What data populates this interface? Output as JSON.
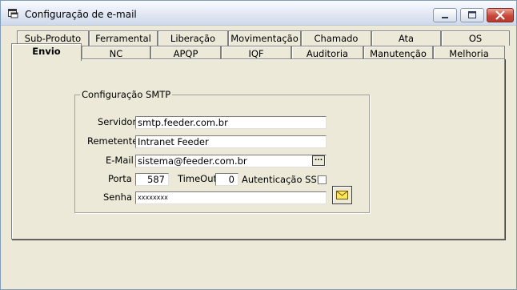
{
  "window": {
    "title": "Configuração de e-mail"
  },
  "tabs_row1": [
    {
      "label": "Sub-Produto"
    },
    {
      "label": "Ferramental"
    },
    {
      "label": "Liberação"
    },
    {
      "label": "Movimentação"
    },
    {
      "label": "Chamado"
    },
    {
      "label": "Ata"
    },
    {
      "label": "OS"
    }
  ],
  "tabs_row2": [
    {
      "label": "Envio",
      "active": true
    },
    {
      "label": "NC"
    },
    {
      "label": "APQP"
    },
    {
      "label": "IQF"
    },
    {
      "label": "Auditoria"
    },
    {
      "label": "Manutenção"
    },
    {
      "label": "Melhoria"
    }
  ],
  "smtp": {
    "group_title": "Configuração SMTP",
    "servidor_label": "Servidor",
    "servidor_value": "smtp.feeder.com.br",
    "remetente_label": "Remetente",
    "remetente_value": "Intranet Feeder",
    "email_label": "E-Mail",
    "email_value": "sistema@feeder.com.br",
    "email_button": "...",
    "porta_label": "Porta",
    "porta_value": "587",
    "timeout_label": "TimeOut",
    "timeout_value": "0",
    "ssl_label": "Autenticação SSL",
    "ssl_checked": false,
    "senha_label": "Senha",
    "senha_value": "xxxxxxxx"
  },
  "colors": {
    "face": "#ECE9D8",
    "close_button": "#C8483A"
  }
}
